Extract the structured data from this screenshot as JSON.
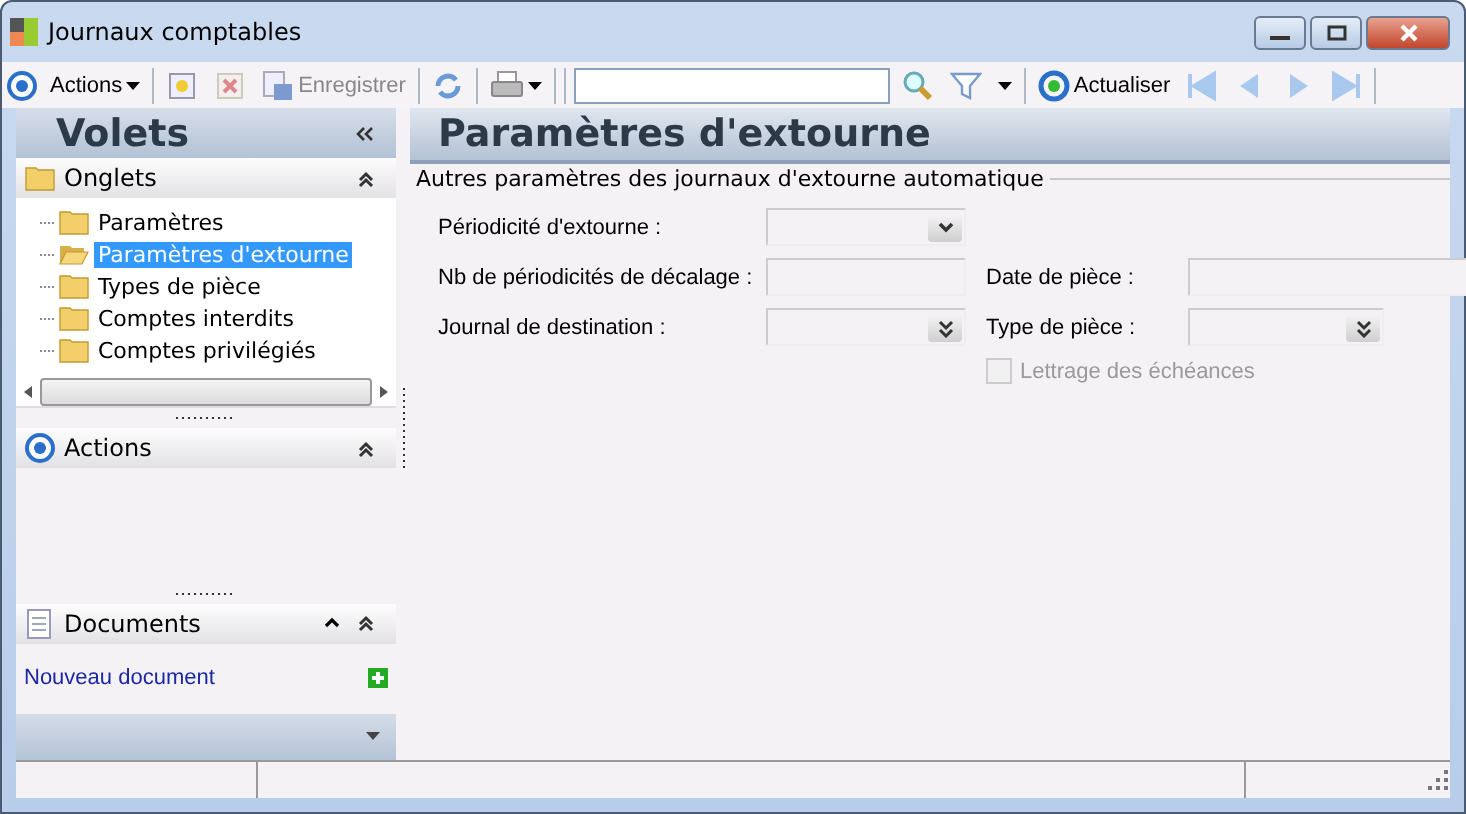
{
  "window": {
    "title": "Journaux comptables"
  },
  "toolbar": {
    "actions_label": "Actions",
    "save_label": "Enregistrer",
    "refresh_label": "Actualiser"
  },
  "sidebar": {
    "title": "Volets",
    "tabs_panel": {
      "title": "Onglets",
      "expanded": true,
      "items": [
        {
          "label": "Paramètres",
          "selected": false
        },
        {
          "label": "Paramètres d'extourne",
          "selected": true
        },
        {
          "label": "Types de pièce",
          "selected": false
        },
        {
          "label": "Comptes interdits",
          "selected": false
        },
        {
          "label": "Comptes privilégiés",
          "selected": false
        }
      ]
    },
    "actions_panel": {
      "title": "Actions"
    },
    "documents_panel": {
      "title": "Documents",
      "link": "Nouveau document"
    }
  },
  "content": {
    "title": "Paramètres d'extourne",
    "group": "Autres paramètres des journaux d'extourne automatique",
    "rows": [
      {
        "left": {
          "kind": "select",
          "label": "Périodicité d'extourne :"
        }
      },
      {
        "left": {
          "kind": "text",
          "label": "Nb de périodicités de décalage :"
        },
        "right": {
          "kind": "text",
          "label": "Date de pièce :"
        }
      },
      {
        "left": {
          "kind": "lookup",
          "label": "Journal de destination :"
        },
        "right": {
          "kind": "lookup",
          "label": "Type de pièce :"
        }
      },
      {
        "right": {
          "kind": "checkbox",
          "label": "Lettrage des échéances",
          "checked": false,
          "disabled": true
        }
      }
    ]
  }
}
